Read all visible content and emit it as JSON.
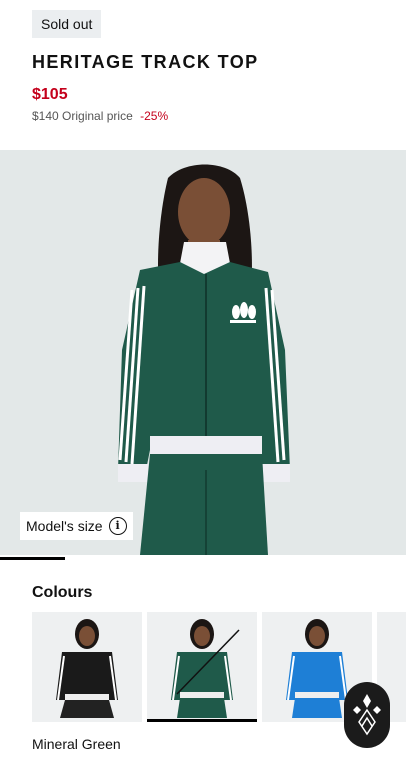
{
  "badge": {
    "label": "Sold out"
  },
  "product": {
    "title": "HERITAGE TRACK TOP",
    "sale_price": "$105",
    "original_price": "$140",
    "original_price_label": "Original price",
    "discount": "-25%"
  },
  "gallery": {
    "model_size_label": "Model's size",
    "progress_fraction": 0.16
  },
  "colours": {
    "heading": "Colours",
    "selected_name": "Mineral Green",
    "swatches": [
      {
        "color_name": "black",
        "tint": "#1a1a1a"
      },
      {
        "color_name": "green",
        "tint": "#1f5a4a",
        "unavailable": true
      },
      {
        "color_name": "blue",
        "tint": "#1e7fd6"
      },
      {
        "color_name": "partial",
        "tint": "#d8dcdd"
      }
    ]
  },
  "colors": {
    "sale_red": "#c4001b",
    "jacket_green": "#1f5a4a",
    "background_grey": "#e3e8e8"
  },
  "icons": {
    "info": "info-icon",
    "assistant": "diamond-sparkle-icon"
  }
}
